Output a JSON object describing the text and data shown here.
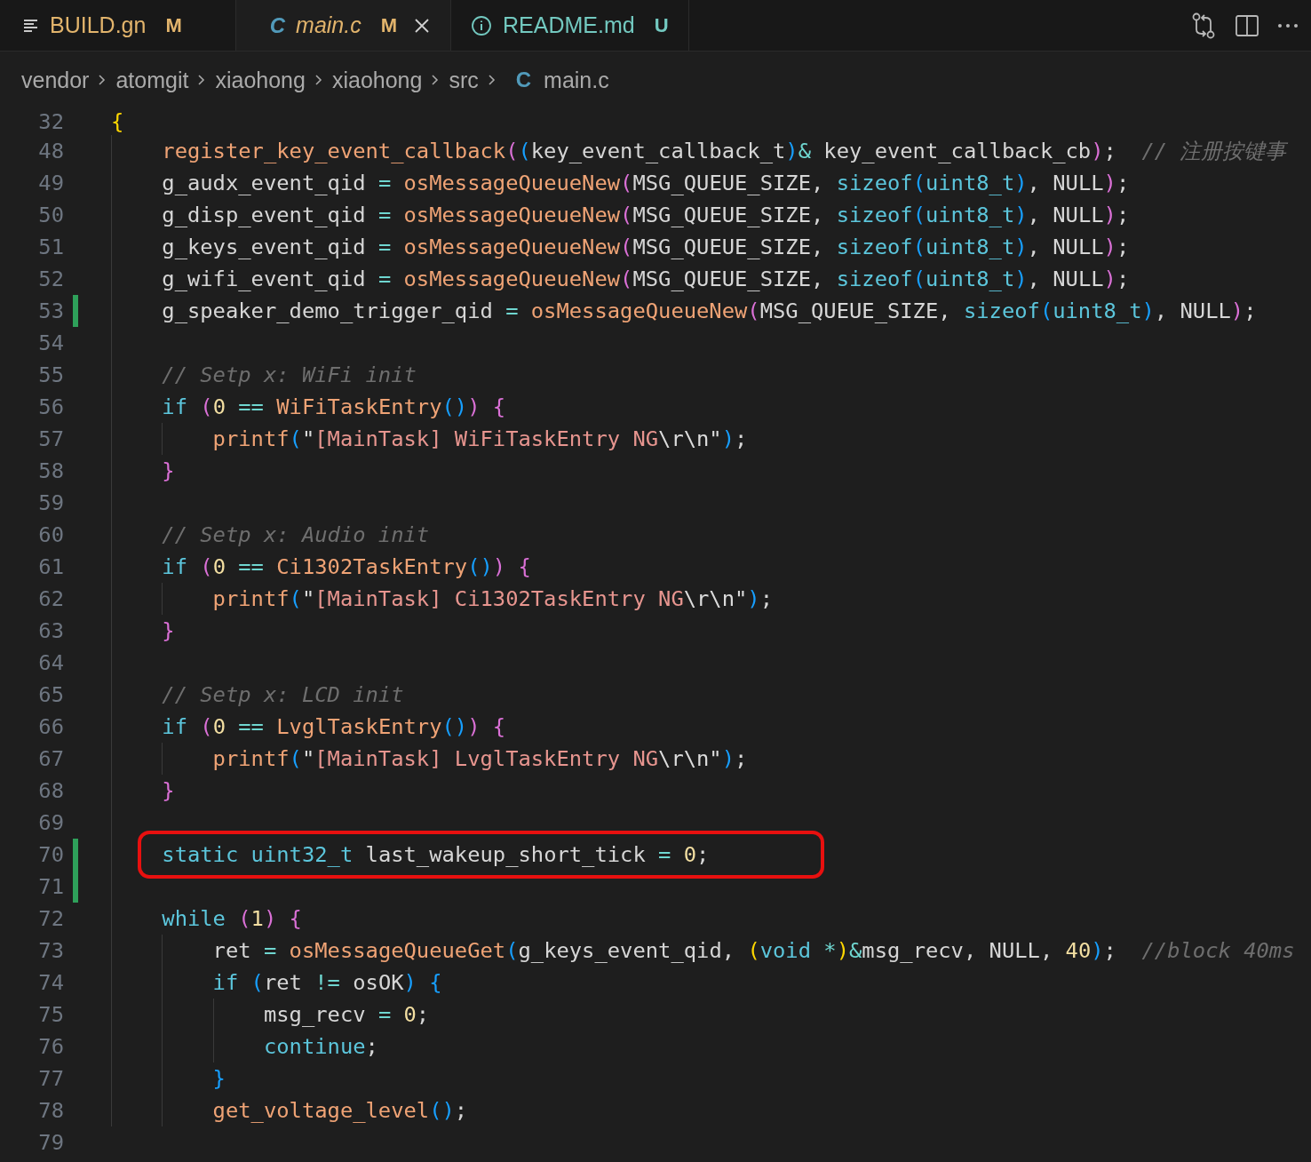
{
  "tabs": [
    {
      "label": "BUILD.gn",
      "kind": "lines",
      "status": "M",
      "color": "#e2b46c",
      "selected": false,
      "preview": false
    },
    {
      "label": "main.c",
      "kind": "c",
      "icon_text": "C",
      "status": "M",
      "color": "#e2b46c",
      "selected": true,
      "preview": true
    },
    {
      "label": "README.md",
      "kind": "info",
      "status": "U",
      "color": "#73c9c0",
      "selected": false,
      "preview": false
    }
  ],
  "breadcrumb": [
    {
      "label": "vendor"
    },
    {
      "label": "atomgit"
    },
    {
      "label": "xiaohong"
    },
    {
      "label": "xiaohong"
    },
    {
      "label": "src"
    },
    {
      "label": "main.c",
      "icon_text": "C"
    }
  ],
  "lines": [
    {
      "number": "32",
      "sticky": true,
      "tokens": [
        {
          "text": "{",
          "kind": "b1"
        }
      ]
    },
    {
      "number": "48",
      "tokens": [
        {
          "text": "    register_key_event_callback",
          "kind": "f"
        },
        {
          "text": "(",
          "kind": "b2"
        },
        {
          "text": "(",
          "kind": "b3"
        },
        {
          "text": "key_event_callback_t",
          "kind": "p"
        },
        {
          "text": ")",
          "kind": "b3"
        },
        {
          "text": "&",
          "kind": "o"
        },
        {
          "text": " key_event_callback_cb",
          "kind": "p"
        },
        {
          "text": ")",
          "kind": "b2"
        },
        {
          "text": ";",
          "kind": "p"
        },
        {
          "text": "  // 注册按键事",
          "kind": "c"
        }
      ]
    },
    {
      "number": "49",
      "tokens": [
        {
          "text": "    g_audx_event_qid ",
          "kind": "p"
        },
        {
          "text": "= ",
          "kind": "o"
        },
        {
          "text": "osMessageQueueNew",
          "kind": "f"
        },
        {
          "text": "(",
          "kind": "b2"
        },
        {
          "text": "MSG_QUEUE_SIZE, ",
          "kind": "p"
        },
        {
          "text": "sizeof",
          "kind": "k"
        },
        {
          "text": "(",
          "kind": "b3"
        },
        {
          "text": "uint8_t",
          "kind": "k"
        },
        {
          "text": ")",
          "kind": "b3"
        },
        {
          "text": ", NULL",
          "kind": "p"
        },
        {
          "text": ")",
          "kind": "b2"
        },
        {
          "text": ";",
          "kind": "p"
        }
      ]
    },
    {
      "number": "50",
      "tokens": [
        {
          "text": "    g_disp_event_qid ",
          "kind": "p"
        },
        {
          "text": "= ",
          "kind": "o"
        },
        {
          "text": "osMessageQueueNew",
          "kind": "f"
        },
        {
          "text": "(",
          "kind": "b2"
        },
        {
          "text": "MSG_QUEUE_SIZE, ",
          "kind": "p"
        },
        {
          "text": "sizeof",
          "kind": "k"
        },
        {
          "text": "(",
          "kind": "b3"
        },
        {
          "text": "uint8_t",
          "kind": "k"
        },
        {
          "text": ")",
          "kind": "b3"
        },
        {
          "text": ", NULL",
          "kind": "p"
        },
        {
          "text": ")",
          "kind": "b2"
        },
        {
          "text": ";",
          "kind": "p"
        }
      ]
    },
    {
      "number": "51",
      "tokens": [
        {
          "text": "    g_keys_event_qid ",
          "kind": "p"
        },
        {
          "text": "= ",
          "kind": "o"
        },
        {
          "text": "osMessageQueueNew",
          "kind": "f"
        },
        {
          "text": "(",
          "kind": "b2"
        },
        {
          "text": "MSG_QUEUE_SIZE, ",
          "kind": "p"
        },
        {
          "text": "sizeof",
          "kind": "k"
        },
        {
          "text": "(",
          "kind": "b3"
        },
        {
          "text": "uint8_t",
          "kind": "k"
        },
        {
          "text": ")",
          "kind": "b3"
        },
        {
          "text": ", NULL",
          "kind": "p"
        },
        {
          "text": ")",
          "kind": "b2"
        },
        {
          "text": ";",
          "kind": "p"
        }
      ]
    },
    {
      "number": "52",
      "tokens": [
        {
          "text": "    g_wifi_event_qid ",
          "kind": "p"
        },
        {
          "text": "= ",
          "kind": "o"
        },
        {
          "text": "osMessageQueueNew",
          "kind": "f"
        },
        {
          "text": "(",
          "kind": "b2"
        },
        {
          "text": "MSG_QUEUE_SIZE, ",
          "kind": "p"
        },
        {
          "text": "sizeof",
          "kind": "k"
        },
        {
          "text": "(",
          "kind": "b3"
        },
        {
          "text": "uint8_t",
          "kind": "k"
        },
        {
          "text": ")",
          "kind": "b3"
        },
        {
          "text": ", NULL",
          "kind": "p"
        },
        {
          "text": ")",
          "kind": "b2"
        },
        {
          "text": ";",
          "kind": "p"
        }
      ]
    },
    {
      "number": "53",
      "added": true,
      "tokens": [
        {
          "text": "    g_speaker_demo_trigger_qid ",
          "kind": "p"
        },
        {
          "text": "= ",
          "kind": "o"
        },
        {
          "text": "osMessageQueueNew",
          "kind": "f"
        },
        {
          "text": "(",
          "kind": "b2"
        },
        {
          "text": "MSG_QUEUE_SIZE, ",
          "kind": "p"
        },
        {
          "text": "sizeof",
          "kind": "k"
        },
        {
          "text": "(",
          "kind": "b3"
        },
        {
          "text": "uint8_t",
          "kind": "k"
        },
        {
          "text": ")",
          "kind": "b3"
        },
        {
          "text": ", NULL",
          "kind": "p"
        },
        {
          "text": ")",
          "kind": "b2"
        },
        {
          "text": ";",
          "kind": "p"
        }
      ]
    },
    {
      "number": "54"
    },
    {
      "number": "55",
      "tokens": [
        {
          "text": "    // Setp x: WiFi init",
          "kind": "c"
        }
      ]
    },
    {
      "number": "56",
      "tokens": [
        {
          "text": "    if ",
          "kind": "k"
        },
        {
          "text": "(",
          "kind": "b2"
        },
        {
          "text": "0 ",
          "kind": "n"
        },
        {
          "text": "== ",
          "kind": "o"
        },
        {
          "text": "WiFiTaskEntry",
          "kind": "f"
        },
        {
          "text": "()",
          "kind": "b3"
        },
        {
          "text": ") ",
          "kind": "b2"
        },
        {
          "text": "{",
          "kind": "b2"
        }
      ]
    },
    {
      "number": "57",
      "tokens": [
        {
          "text": "        printf",
          "kind": "f"
        },
        {
          "text": "(",
          "kind": "b3"
        },
        {
          "text": "\"",
          "kind": "e"
        },
        {
          "text": "[MainTask] WiFiTaskEntry NG",
          "kind": "s"
        },
        {
          "text": "\\r\\n\"",
          "kind": "e"
        },
        {
          "text": ")",
          "kind": "b3"
        },
        {
          "text": ";",
          "kind": "p"
        }
      ]
    },
    {
      "number": "58",
      "tokens": [
        {
          "text": "    }",
          "kind": "b2"
        }
      ]
    },
    {
      "number": "59"
    },
    {
      "number": "60",
      "tokens": [
        {
          "text": "    // Setp x: Audio init",
          "kind": "c"
        }
      ]
    },
    {
      "number": "61",
      "tokens": [
        {
          "text": "    if ",
          "kind": "k"
        },
        {
          "text": "(",
          "kind": "b2"
        },
        {
          "text": "0 ",
          "kind": "n"
        },
        {
          "text": "== ",
          "kind": "o"
        },
        {
          "text": "Ci1302TaskEntry",
          "kind": "f"
        },
        {
          "text": "()",
          "kind": "b3"
        },
        {
          "text": ") ",
          "kind": "b2"
        },
        {
          "text": "{",
          "kind": "b2"
        }
      ]
    },
    {
      "number": "62",
      "tokens": [
        {
          "text": "        printf",
          "kind": "f"
        },
        {
          "text": "(",
          "kind": "b3"
        },
        {
          "text": "\"",
          "kind": "e"
        },
        {
          "text": "[MainTask] Ci1302TaskEntry NG",
          "kind": "s"
        },
        {
          "text": "\\r\\n\"",
          "kind": "e"
        },
        {
          "text": ")",
          "kind": "b3"
        },
        {
          "text": ";",
          "kind": "p"
        }
      ]
    },
    {
      "number": "63",
      "tokens": [
        {
          "text": "    }",
          "kind": "b2"
        }
      ]
    },
    {
      "number": "64"
    },
    {
      "number": "65",
      "tokens": [
        {
          "text": "    // Setp x: LCD init",
          "kind": "c"
        }
      ]
    },
    {
      "number": "66",
      "tokens": [
        {
          "text": "    if ",
          "kind": "k"
        },
        {
          "text": "(",
          "kind": "b2"
        },
        {
          "text": "0 ",
          "kind": "n"
        },
        {
          "text": "== ",
          "kind": "o"
        },
        {
          "text": "LvglTaskEntry",
          "kind": "f"
        },
        {
          "text": "()",
          "kind": "b3"
        },
        {
          "text": ") ",
          "kind": "b2"
        },
        {
          "text": "{",
          "kind": "b2"
        }
      ]
    },
    {
      "number": "67",
      "tokens": [
        {
          "text": "        printf",
          "kind": "f"
        },
        {
          "text": "(",
          "kind": "b3"
        },
        {
          "text": "\"",
          "kind": "e"
        },
        {
          "text": "[MainTask] LvglTaskEntry NG",
          "kind": "s"
        },
        {
          "text": "\\r\\n\"",
          "kind": "e"
        },
        {
          "text": ")",
          "kind": "b3"
        },
        {
          "text": ";",
          "kind": "p"
        }
      ]
    },
    {
      "number": "68",
      "tokens": [
        {
          "text": "    }",
          "kind": "b2"
        }
      ]
    },
    {
      "number": "69"
    },
    {
      "number": "70",
      "added": true,
      "boxed": true,
      "tokens": [
        {
          "text": "    static ",
          "kind": "k"
        },
        {
          "text": "uint32_t ",
          "kind": "k"
        },
        {
          "text": "last_wakeup_short_tick ",
          "kind": "p"
        },
        {
          "text": "= ",
          "kind": "o"
        },
        {
          "text": "0",
          "kind": "n"
        },
        {
          "text": ";",
          "kind": "p"
        }
      ]
    },
    {
      "number": "71",
      "added": true
    },
    {
      "number": "72",
      "tokens": [
        {
          "text": "    while ",
          "kind": "k"
        },
        {
          "text": "(",
          "kind": "b2"
        },
        {
          "text": "1",
          "kind": "n"
        },
        {
          "text": ") ",
          "kind": "b2"
        },
        {
          "text": "{",
          "kind": "b2"
        }
      ]
    },
    {
      "number": "73",
      "tokens": [
        {
          "text": "        ret ",
          "kind": "p"
        },
        {
          "text": "= ",
          "kind": "o"
        },
        {
          "text": "osMessageQueueGet",
          "kind": "f"
        },
        {
          "text": "(",
          "kind": "b3"
        },
        {
          "text": "g_keys_event_qid, ",
          "kind": "p"
        },
        {
          "text": "(",
          "kind": "b1"
        },
        {
          "text": "void ",
          "kind": "k"
        },
        {
          "text": "*",
          "kind": "o"
        },
        {
          "text": ")",
          "kind": "b1"
        },
        {
          "text": "&",
          "kind": "o"
        },
        {
          "text": "msg_recv, NULL, ",
          "kind": "p"
        },
        {
          "text": "40",
          "kind": "n"
        },
        {
          "text": ")",
          "kind": "b3"
        },
        {
          "text": ";",
          "kind": "p"
        },
        {
          "text": "  //block 40ms",
          "kind": "c"
        }
      ]
    },
    {
      "number": "74",
      "tokens": [
        {
          "text": "        if ",
          "kind": "k"
        },
        {
          "text": "(",
          "kind": "b3"
        },
        {
          "text": "ret ",
          "kind": "p"
        },
        {
          "text": "!= ",
          "kind": "o"
        },
        {
          "text": "osOK",
          "kind": "p"
        },
        {
          "text": ") ",
          "kind": "b3"
        },
        {
          "text": "{",
          "kind": "b3"
        }
      ]
    },
    {
      "number": "75",
      "tokens": [
        {
          "text": "            msg_recv ",
          "kind": "p"
        },
        {
          "text": "= ",
          "kind": "o"
        },
        {
          "text": "0",
          "kind": "n"
        },
        {
          "text": ";",
          "kind": "p"
        }
      ]
    },
    {
      "number": "76",
      "tokens": [
        {
          "text": "            continue",
          "kind": "k"
        },
        {
          "text": ";",
          "kind": "p"
        }
      ]
    },
    {
      "number": "77",
      "tokens": [
        {
          "text": "        }",
          "kind": "b3"
        }
      ]
    },
    {
      "number": "78",
      "tokens": [
        {
          "text": "        get_voltage_level",
          "kind": "f"
        },
        {
          "text": "()",
          "kind": "b3"
        },
        {
          "text": ";",
          "kind": "p"
        }
      ]
    },
    {
      "number": "79"
    }
  ]
}
